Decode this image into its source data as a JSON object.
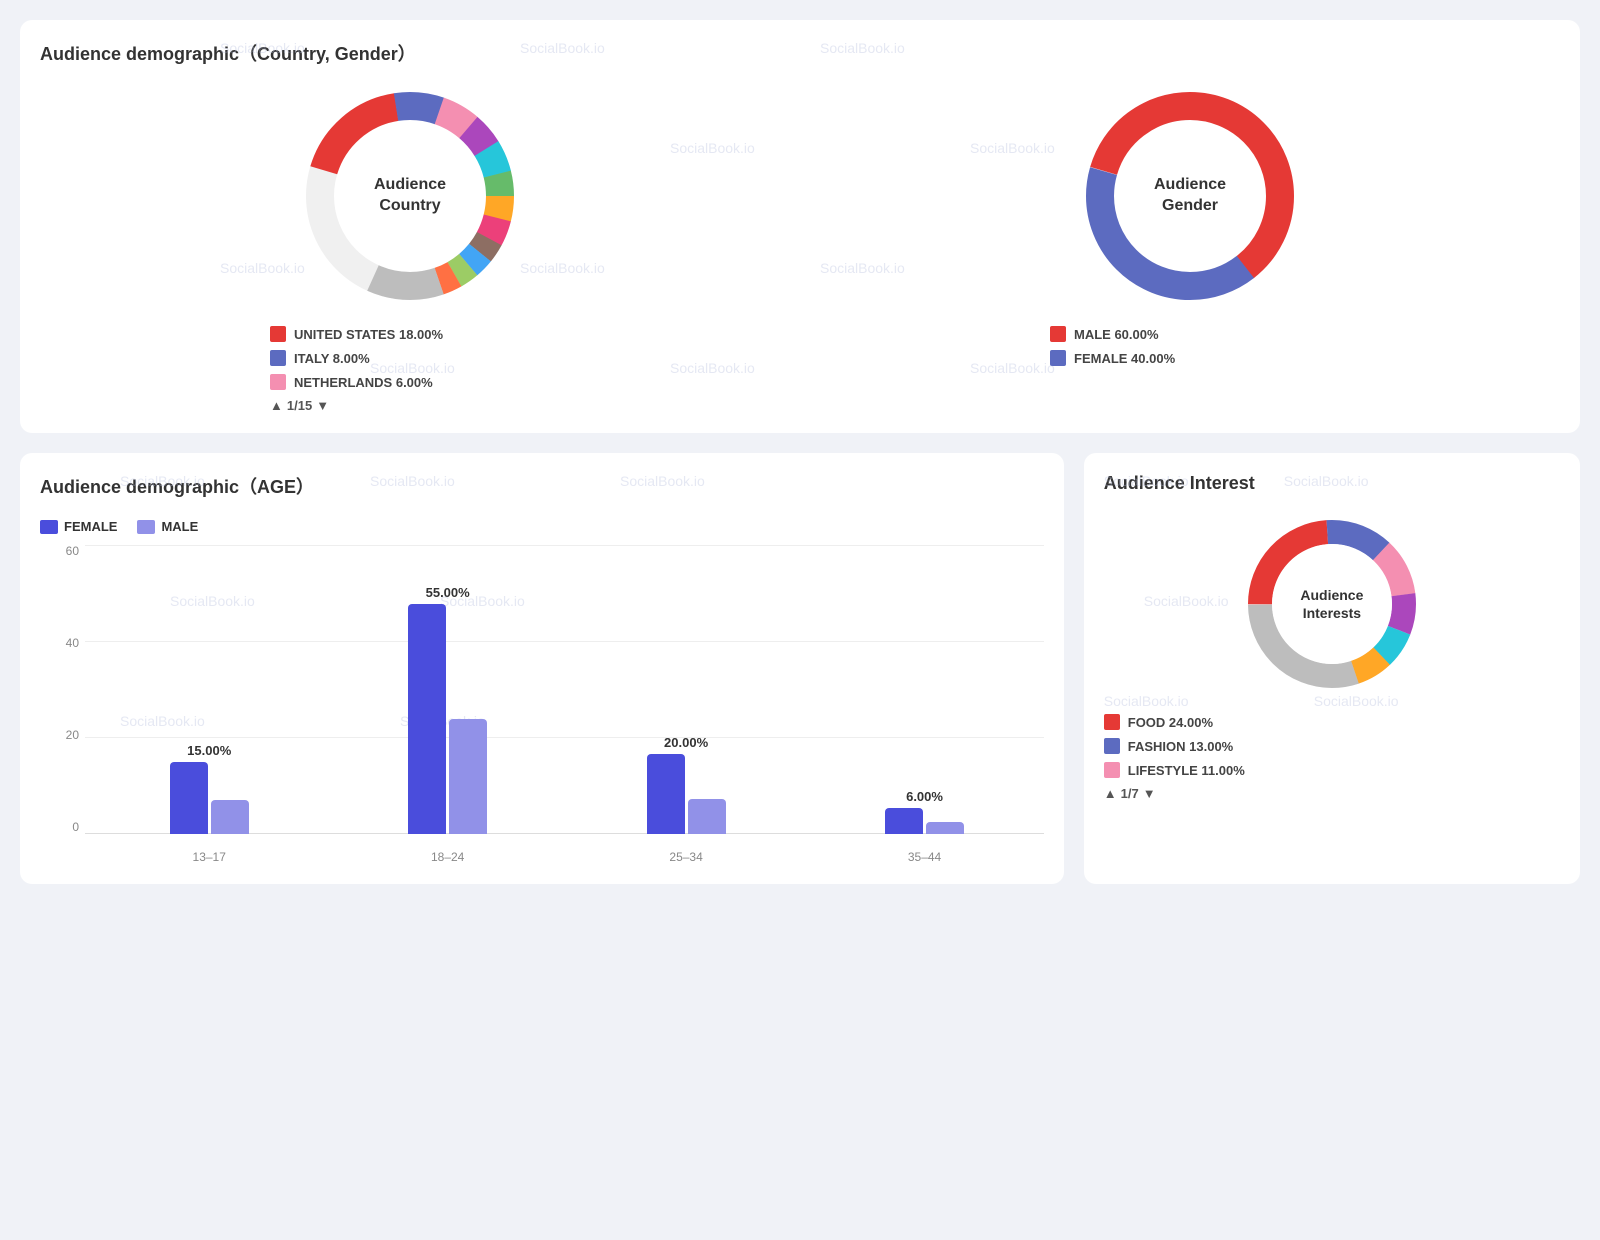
{
  "top_card": {
    "title": "Audience demographic（Country, Gender）",
    "country_chart": {
      "label": "Audience\nCountry",
      "segments": [
        {
          "color": "#e53935",
          "pct": 18,
          "label": "UNITED STATES 18.00%"
        },
        {
          "color": "#5c6bc0",
          "pct": 8,
          "label": "ITALY 8.00%"
        },
        {
          "color": "#f48fb1",
          "pct": 6,
          "label": "NETHERLANDS 6.00%"
        },
        {
          "color": "#ab47bc",
          "pct": 5
        },
        {
          "color": "#26c6da",
          "pct": 5
        },
        {
          "color": "#66bb6a",
          "pct": 4
        },
        {
          "color": "#ffa726",
          "pct": 4
        },
        {
          "color": "#ec407a",
          "pct": 4
        },
        {
          "color": "#8d6e63",
          "pct": 3
        },
        {
          "color": "#42a5f5",
          "pct": 3
        },
        {
          "color": "#9ccc65",
          "pct": 3
        },
        {
          "color": "#ff7043",
          "pct": 3
        },
        {
          "color": "#bdbdbd",
          "pct": 12
        },
        {
          "color": "#e0e0e0",
          "pct": 22
        }
      ],
      "legend": [
        {
          "color": "#e53935",
          "text": "UNITED STATES 18.00%"
        },
        {
          "color": "#5c6bc0",
          "text": "ITALY 8.00%"
        },
        {
          "color": "#f48fb1",
          "text": "NETHERLANDS 6.00%"
        }
      ],
      "page": "1/15"
    },
    "gender_chart": {
      "label": "Audience\nGender",
      "segments": [
        {
          "color": "#e53935",
          "pct": 60
        },
        {
          "color": "#5c6bc0",
          "pct": 40
        }
      ],
      "legend": [
        {
          "color": "#e53935",
          "text": "MALE 60.00%"
        },
        {
          "color": "#5c6bc0",
          "text": "FEMALE 40.00%"
        }
      ]
    }
  },
  "age_card": {
    "title": "Audience demographic（AGE）",
    "legend": [
      {
        "color": "#4a4ddc",
        "text": "FEMALE"
      },
      {
        "color": "#9191e8",
        "text": "MALE"
      }
    ],
    "y_labels": [
      "0",
      "20",
      "40",
      "60"
    ],
    "bars": [
      {
        "age": "13–17",
        "pct": 15.0,
        "female_h": 65,
        "male_h": 30
      },
      {
        "age": "18–24",
        "pct": 55.0,
        "female_h": 210,
        "male_h": 105
      },
      {
        "age": "25–34",
        "pct": 20.0,
        "female_h": 75,
        "male_h": 30
      },
      {
        "age": "35–44",
        "pct": 6.0,
        "female_h": 25,
        "male_h": 10
      }
    ]
  },
  "interest_card": {
    "title": "Audience Interest",
    "donut_label": "Audience\nInterests",
    "segments": [
      {
        "color": "#e53935",
        "pct": 24
      },
      {
        "color": "#5c6bc0",
        "pct": 13
      },
      {
        "color": "#f48fb1",
        "pct": 11
      },
      {
        "color": "#ab47bc",
        "pct": 8
      },
      {
        "color": "#26c6da",
        "pct": 7
      },
      {
        "color": "#ffa726",
        "pct": 7
      },
      {
        "color": "#bdbdbd",
        "pct": 30
      }
    ],
    "legend": [
      {
        "color": "#e53935",
        "text": "FOOD 24.00%"
      },
      {
        "color": "#5c6bc0",
        "text": "FASHION 13.00%"
      },
      {
        "color": "#f48fb1",
        "text": "LIFESTYLE 11.00%"
      }
    ],
    "page": "1/7"
  },
  "watermark": "SocialBook.io"
}
